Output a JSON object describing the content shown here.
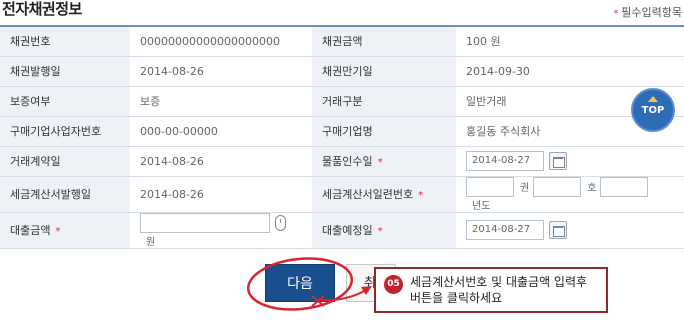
{
  "header": {
    "title": "전자채권정보",
    "required_star": "*",
    "required_note": "필수입력항목"
  },
  "rows": [
    {
      "label1": "채권번호",
      "value1": "00000000000000000000",
      "label2": "채권금액",
      "value2": "100 원"
    },
    {
      "label1": "채권발행일",
      "value1": "2014-08-26",
      "label2": "채권만기일",
      "value2": "2014-09-30"
    },
    {
      "label1": "보증여부",
      "value1": "보증",
      "label2": "거래구분",
      "value2": "일반거래"
    },
    {
      "label1": "구매기업사업자번호",
      "value1": "000-00-00000",
      "label2": "구매기업명",
      "value2": "홍길동 주식회사"
    }
  ],
  "row5": {
    "label1": "거래계약일",
    "value1": "2014-08-26",
    "label2": "물품인수일",
    "req": "*",
    "date": "2014-08-27"
  },
  "row6": {
    "label1": "세금계산서발행일",
    "value1": "2014-08-26",
    "label2": "세금계산서일련번호",
    "req": "*",
    "field1": "",
    "unit1": "권",
    "field2": "",
    "unit2": "호",
    "field3": "",
    "unit3": "년도"
  },
  "row7": {
    "label1": "대출금액",
    "req1": "*",
    "amount": "",
    "unit": "원",
    "label2": "대출예정일",
    "req2": "*",
    "date": "2014-08-27"
  },
  "top_button": {
    "label": "TOP"
  },
  "actions": {
    "next_label": "다음",
    "cancel_label": "취소"
  },
  "callout": {
    "number": "05",
    "line1": "세금계산서번호 및 대출금액 입력후",
    "line2": "버튼을 클릭하세요"
  },
  "colors": {
    "header_line": "#6b8fb8",
    "label_bg": "#eef2f7",
    "primary": "#1a4f8f",
    "required": "#d2283c",
    "guide_red": "#d9252f"
  }
}
